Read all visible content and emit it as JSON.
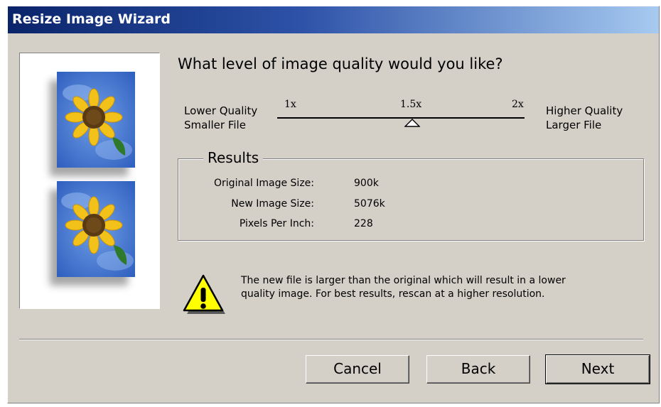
{
  "window": {
    "title": "Resize Image Wizard"
  },
  "question": "What level of image quality would you like?",
  "slider": {
    "left_label_line1": "Lower Quality",
    "left_label_line2": "Smaller File",
    "right_label_line1": "Higher Quality",
    "right_label_line2": "Larger File",
    "ticks": [
      "1x",
      "1.5x",
      "2x"
    ],
    "value": "1.5x"
  },
  "results": {
    "title": "Results",
    "rows": [
      {
        "label": "Original Image Size:",
        "value": "900k"
      },
      {
        "label": "New Image Size:",
        "value": "5076k"
      },
      {
        "label": "Pixels Per Inch:",
        "value": "228"
      }
    ]
  },
  "warning": {
    "icon": "warning-icon",
    "text": "The new file is larger than the original which will result in a lower quality image.  For best results, rescan at a higher resolution."
  },
  "buttons": {
    "cancel": "Cancel",
    "back": "Back",
    "next": "Next"
  },
  "colors": {
    "titlebar_start": "#0a246a",
    "titlebar_end": "#a6caf0",
    "dialog_face": "#d4d0c8",
    "warning_yellow": "#ffff00"
  }
}
